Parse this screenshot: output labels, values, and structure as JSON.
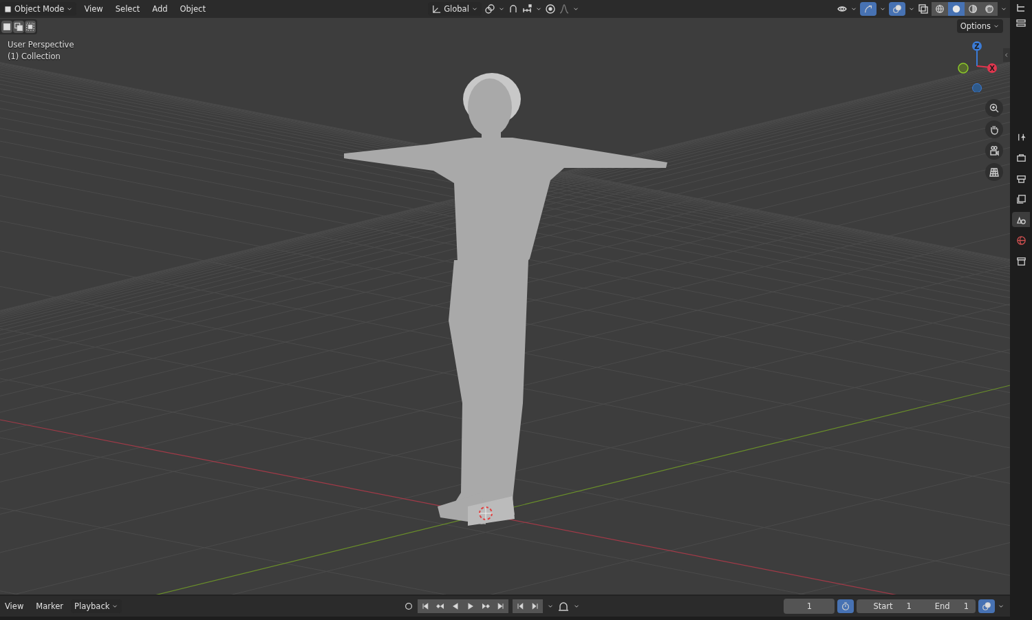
{
  "header": {
    "mode": "Object Mode",
    "menus": [
      "View",
      "Select",
      "Add",
      "Object"
    ],
    "orientation": "Global"
  },
  "header_toggles": {
    "gizmos_on": true,
    "overlays_on": true
  },
  "shading_modes": [
    {
      "kind": "wireframe",
      "selected": false
    },
    {
      "kind": "solid",
      "selected": true
    },
    {
      "kind": "material",
      "selected": false
    },
    {
      "kind": "rendered",
      "selected": false
    }
  ],
  "viewport": {
    "perspective": "User Perspective",
    "collection": "(1) Collection",
    "options": "Options",
    "axis_z": "Z",
    "axis_x": "X"
  },
  "properties_tabs": [
    {
      "kind": "tool",
      "selected": false
    },
    {
      "kind": "render",
      "selected": false
    },
    {
      "kind": "output",
      "selected": false
    },
    {
      "kind": "view_layer",
      "selected": false
    },
    {
      "kind": "scene",
      "selected": true
    },
    {
      "kind": "world",
      "selected": false
    },
    {
      "kind": "collection",
      "selected": false
    }
  ],
  "timeline": {
    "menus": [
      "View",
      "Marker"
    ],
    "playback": "Playback",
    "current_frame": "1",
    "preview_range_on": true,
    "start_label": "Start",
    "start": "1",
    "end_label": "End",
    "end": "1"
  }
}
